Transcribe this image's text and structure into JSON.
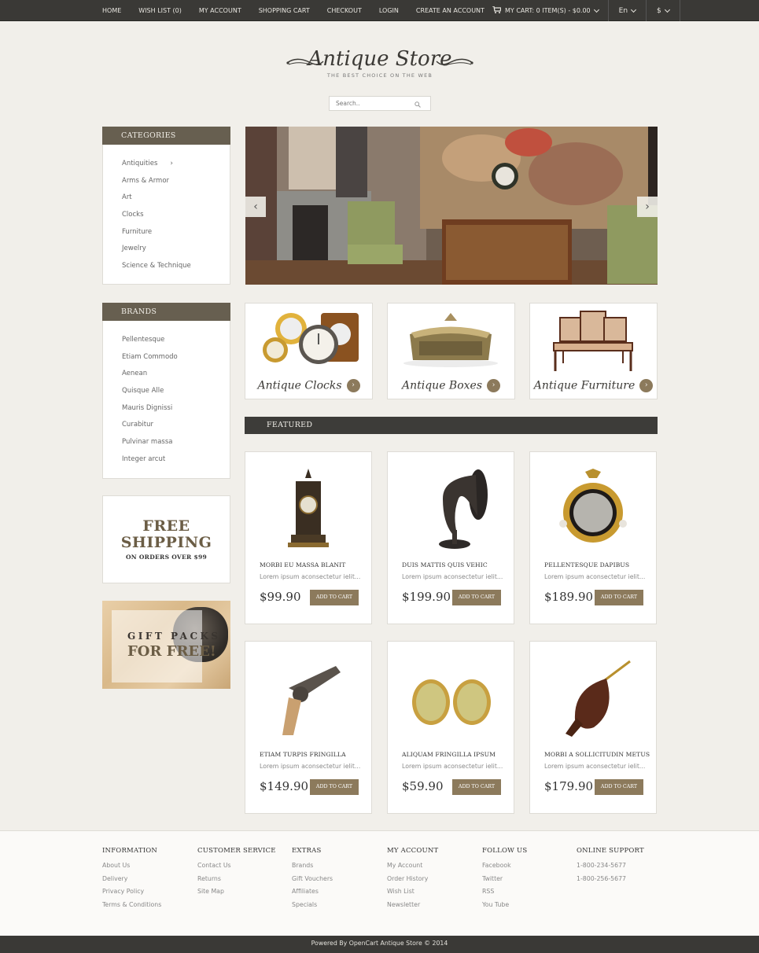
{
  "topnav": {
    "links": [
      "HOME",
      "WISH LIST (0)",
      "MY ACCOUNT",
      "SHOPPING CART",
      "CHECKOUT",
      "LOGIN",
      "CREATE AN ACCOUNT"
    ],
    "cart_label": "MY CART: 0 ITEM(S) - $0.00",
    "language": "En",
    "currency": "$"
  },
  "header": {
    "logo_title": "Antique Store",
    "tagline": "THE BEST CHOICE ON THE WEB",
    "search_placeholder": "Search.."
  },
  "categories": {
    "title": "CATEGORIES",
    "items": [
      "Antiquities",
      "Arms & Armor",
      "Art",
      "Clocks",
      "Furniture",
      "Jewelry",
      "Science & Technique"
    ],
    "expand_glyph": "›"
  },
  "brands": {
    "title": "BRANDS",
    "items": [
      "Pellentesque",
      "Etiam Commodo",
      "Aenean",
      "Quisque Alle",
      "Mauris Dignissi",
      "Curabitur",
      "Pulvinar massa",
      "Integer arcut"
    ]
  },
  "promo_shipping": {
    "line1": "FREE",
    "line2": "SHIPPING",
    "line3": "ON ORDERS OVER $99"
  },
  "promo_gift": {
    "line1": "GIFT PACKS",
    "line2": "FOR FREE!"
  },
  "slider": {
    "prev": "‹",
    "next": "›"
  },
  "banners": [
    {
      "caption": "Antique Clocks",
      "arrow": "›"
    },
    {
      "caption": "Antique Boxes",
      "arrow": "›"
    },
    {
      "caption": "Antique Furniture",
      "arrow": "›"
    }
  ],
  "featured": {
    "title": "FEATURED",
    "add_label": "ADD TO CART",
    "products": [
      {
        "name": "MORBI EU MASSA BLANIT",
        "desc": "Lorem ipsum aconsectetur ielit...",
        "price": "$99.90"
      },
      {
        "name": "DUIS MATTIS QUIS VEHIC",
        "desc": "Lorem ipsum aconsectetur ielit...",
        "price": "$199.90"
      },
      {
        "name": "PELLENTESQUE DAPIBUS",
        "desc": "Lorem ipsum aconsectetur ielit...",
        "price": "$189.90"
      },
      {
        "name": "ETIAM TURPIS FRINGILLA",
        "desc": "Lorem ipsum aconsectetur ielit...",
        "price": "$149.90"
      },
      {
        "name": "ALIQUAM FRINGILLA IPSUM",
        "desc": "Lorem ipsum aconsectetur ielit...",
        "price": "$59.90"
      },
      {
        "name": "MORBI A SOLLICITUDIN METUS",
        "desc": "Lorem ipsum aconsectetur ielit...",
        "price": "$179.90"
      }
    ]
  },
  "footer": {
    "columns": [
      {
        "title": "INFORMATION",
        "links": [
          "About Us",
          "Delivery",
          "Privacy Policy",
          "Terms & Conditions"
        ]
      },
      {
        "title": "CUSTOMER SERVICE",
        "links": [
          "Contact Us",
          "Returns",
          "Site Map"
        ]
      },
      {
        "title": "EXTRAS",
        "links": [
          "Brands",
          "Gift Vouchers",
          "Affiliates",
          "Specials"
        ]
      },
      {
        "title": "MY ACCOUNT",
        "links": [
          "My Account",
          "Order History",
          "Wish List",
          "Newsletter"
        ]
      },
      {
        "title": "FOLLOW US",
        "links": [
          "Facebook",
          "Twitter",
          "RSS",
          "You Tube"
        ]
      },
      {
        "title": "ONLINE SUPPORT",
        "links": [
          "1-800-234-5677",
          "1-800-256-5677"
        ]
      }
    ],
    "copyright": "Powered By OpenCart  Antique Store © 2014"
  },
  "colors": {
    "accent": "#8c7a5c",
    "sidebar_header": "#675f50",
    "dark_bar": "#3a3936",
    "page_bg": "#f1efea"
  }
}
